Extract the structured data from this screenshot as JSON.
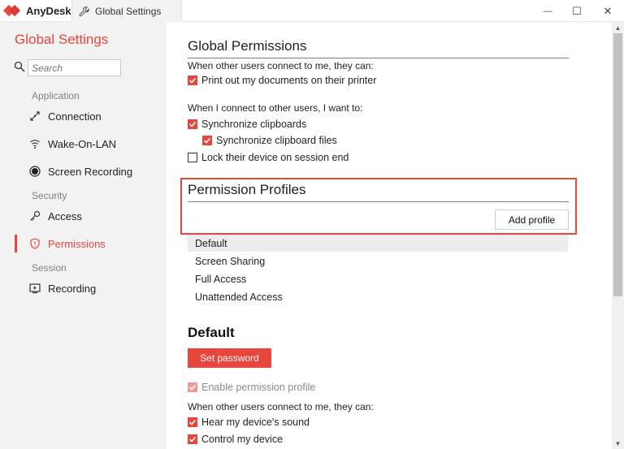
{
  "titlebar": {
    "app_name": "AnyDesk",
    "tab_label": "Global Settings",
    "minimize_glyph": "—",
    "maximize_glyph": "☐",
    "close_glyph": "✕"
  },
  "sidebar": {
    "title": "Global Settings",
    "search_placeholder": "Search",
    "sections": [
      {
        "label": "Application",
        "items": [
          {
            "label": "Connection",
            "icon": "connection-icon"
          },
          {
            "label": "Wake-On-LAN",
            "icon": "wifi-icon"
          },
          {
            "label": "Screen Recording",
            "icon": "record-icon"
          }
        ]
      },
      {
        "label": "Security",
        "items": [
          {
            "label": "Access",
            "icon": "key-icon"
          },
          {
            "label": "Permissions",
            "icon": "shield-icon",
            "active": true
          }
        ]
      },
      {
        "label": "Session",
        "items": [
          {
            "label": "Recording",
            "icon": "play-screen-icon"
          }
        ]
      }
    ]
  },
  "main": {
    "global_permissions": {
      "title": "Global Permissions",
      "incoming_label": "When other users connect to me, they can:",
      "print_docs": "Print out my documents on their printer",
      "outgoing_label": "When I connect to other users, I want to:",
      "sync_clipboards": "Synchronize clipboards",
      "sync_clipboard_files": "Synchronize clipboard files",
      "lock_device": "Lock their device on session end"
    },
    "permission_profiles": {
      "title": "Permission Profiles",
      "add_button": "Add profile",
      "profiles": [
        "Default",
        "Screen Sharing",
        "Full Access",
        "Unattended Access"
      ]
    },
    "profile_detail": {
      "title": "Default",
      "set_password": "Set password",
      "enable_profile": "Enable permission profile",
      "incoming_label": "When other users connect to me, they can:",
      "hear_sound": "Hear my device's sound",
      "control_device": "Control my device"
    }
  },
  "colors": {
    "accent": "#e8453c",
    "sidebar_bg": "#f2f2f2",
    "selected_row": "#ececec"
  }
}
